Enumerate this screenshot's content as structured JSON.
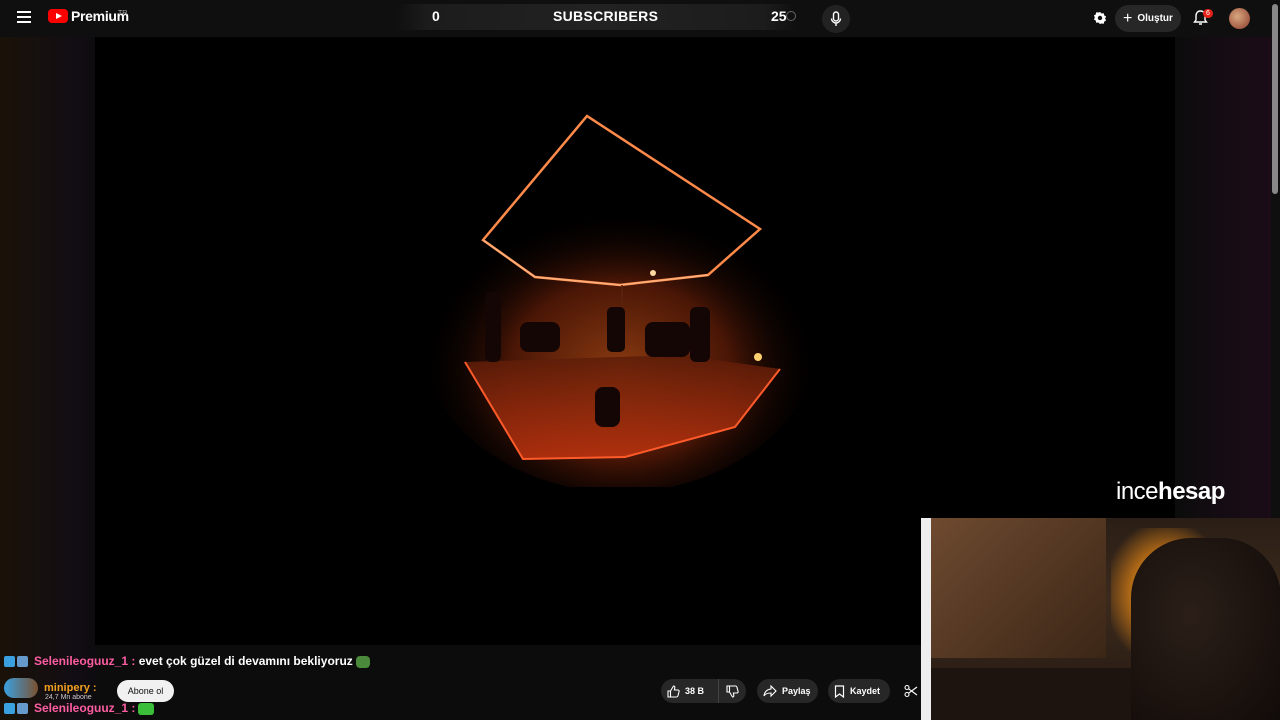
{
  "topbar": {
    "logo_text": "Premium",
    "logo_region": "TR",
    "subscriber_overlay": {
      "left_value": "0",
      "title": "SUBSCRIBERS",
      "right_value": "25"
    },
    "create_label": "Oluştur",
    "notification_count": "6"
  },
  "player": {
    "watermark_thin": "ince",
    "watermark_bold": "hesap"
  },
  "chat": [
    {
      "user": "Selenileoguuz_1 :",
      "message": "evet çok güzel di devamını bekliyoruz"
    },
    {
      "user": "minipery :",
      "sub_count": "24,7 Mn abone",
      "button": "Abone ol"
    },
    {
      "user": "Selenileoguuz_1 :"
    }
  ],
  "actions": {
    "like_count": "38 B",
    "share_label": "Paylaş",
    "save_label": "Kaydet"
  },
  "colors": {
    "accent": "#ff0000",
    "chat_user": "#ff5da2",
    "chat_user_alt": "#f0a020",
    "stage_glow": "#ff6a1a"
  }
}
